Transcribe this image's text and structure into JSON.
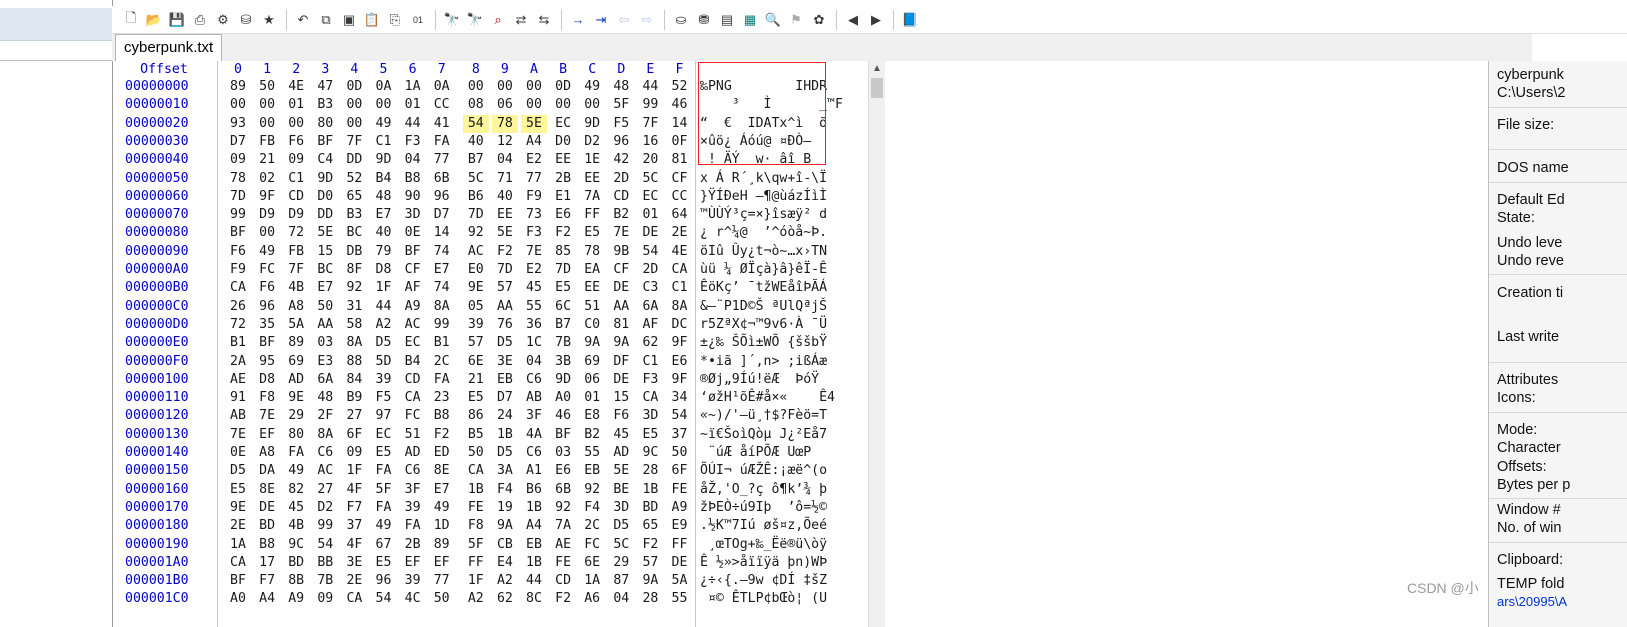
{
  "tab": {
    "filename": "cyberpunk.txt"
  },
  "hex": {
    "offset_header": "Offset",
    "columns": [
      "0",
      "1",
      "2",
      "3",
      "4",
      "5",
      "6",
      "7",
      "8",
      "9",
      "A",
      "B",
      "C",
      "D",
      "E",
      "F"
    ],
    "rows": [
      {
        "off": "00000000",
        "bytes": [
          "89",
          "50",
          "4E",
          "47",
          "0D",
          "0A",
          "1A",
          "0A",
          "00",
          "00",
          "00",
          "0D",
          "49",
          "48",
          "44",
          "52"
        ],
        "text": "‰PNG        IHDR"
      },
      {
        "off": "00000010",
        "bytes": [
          "00",
          "00",
          "01",
          "B3",
          "00",
          "00",
          "01",
          "CC",
          "08",
          "06",
          "00",
          "00",
          "00",
          "5F",
          "99",
          "46"
        ],
        "text": "    ³   Ì      _™F"
      },
      {
        "off": "00000020",
        "bytes": [
          "93",
          "00",
          "00",
          "80",
          "00",
          "49",
          "44",
          "41",
          "54",
          "78",
          "5E",
          "EC",
          "9D",
          "F5",
          "7F",
          "14"
        ],
        "text": "“  €  IDATx^ì  õ "
      },
      {
        "off": "00000030",
        "bytes": [
          "D7",
          "FB",
          "F6",
          "BF",
          "7F",
          "C1",
          "F3",
          "FA",
          "40",
          "12",
          "A4",
          "D0",
          "D2",
          "96",
          "16",
          "0F"
        ],
        "text": "×ûö¿ Áóú@ ¤ÐÒ–  "
      },
      {
        "off": "00000040",
        "bytes": [
          "09",
          "21",
          "09",
          "C4",
          "DD",
          "9D",
          "04",
          "77",
          "B7",
          "04",
          "E2",
          "EE",
          "1E",
          "42",
          "20",
          "81"
        ],
        "text": " ! ÄÝ  w· âî B  "
      },
      {
        "off": "00000050",
        "bytes": [
          "78",
          "02",
          "C1",
          "9D",
          "52",
          "B4",
          "B8",
          "6B",
          "5C",
          "71",
          "77",
          "2B",
          "EE",
          "2D",
          "5C",
          "CF"
        ],
        "text": "x Á R´¸k\\qw+î-\\Ï"
      },
      {
        "off": "00000060",
        "bytes": [
          "7D",
          "9F",
          "CD",
          "D0",
          "65",
          "48",
          "90",
          "96",
          "B6",
          "40",
          "F9",
          "E1",
          "7A",
          "CD",
          "EC",
          "CC"
        ],
        "text": "}ŸÍÐeH –¶@ùázÍìÌ"
      },
      {
        "off": "00000070",
        "bytes": [
          "99",
          "D9",
          "D9",
          "DD",
          "B3",
          "E7",
          "3D",
          "D7",
          "7D",
          "EE",
          "73",
          "E6",
          "FF",
          "B2",
          "01",
          "64"
        ],
        "text": "™ÙÙÝ³ç=×}îsæÿ² d"
      },
      {
        "off": "00000080",
        "bytes": [
          "BF",
          "00",
          "72",
          "5E",
          "BC",
          "40",
          "0E",
          "14",
          "92",
          "5E",
          "F3",
          "F2",
          "E5",
          "7E",
          "DE",
          "2E"
        ],
        "text": "¿ r^¼@  ’^óòå~Þ."
      },
      {
        "off": "00000090",
        "bytes": [
          "F6",
          "49",
          "FB",
          "15",
          "DB",
          "79",
          "BF",
          "74",
          "AC",
          "F2",
          "7E",
          "85",
          "78",
          "9B",
          "54",
          "4E"
        ],
        "text": "öIû Ûy¿t¬ò~…x›TN"
      },
      {
        "off": "000000A0",
        "bytes": [
          "F9",
          "FC",
          "7F",
          "BC",
          "8F",
          "D8",
          "CF",
          "E7",
          "E0",
          "7D",
          "E2",
          "7D",
          "EA",
          "CF",
          "2D",
          "CA"
        ],
        "text": "ùü ¼ ØÏçà}â}êÏ-Ê"
      },
      {
        "off": "000000B0",
        "bytes": [
          "CA",
          "F6",
          "4B",
          "E7",
          "92",
          "1F",
          "AF",
          "74",
          "9E",
          "57",
          "45",
          "E5",
          "EE",
          "DE",
          "C3",
          "C1"
        ],
        "text": "ÊöKç’ ¯tžWEåîÞÃÁ"
      },
      {
        "off": "000000C0",
        "bytes": [
          "26",
          "96",
          "A8",
          "50",
          "31",
          "44",
          "A9",
          "8A",
          "05",
          "AA",
          "55",
          "6C",
          "51",
          "AA",
          "6A",
          "8A"
        ],
        "text": "&–¨P1D©Š ªUlQªjŠ"
      },
      {
        "off": "000000D0",
        "bytes": [
          "72",
          "35",
          "5A",
          "AA",
          "58",
          "A2",
          "AC",
          "99",
          "39",
          "76",
          "36",
          "B7",
          "C0",
          "81",
          "AF",
          "DC"
        ],
        "text": "r5ZªX¢¬™9v6·À ¯Ü"
      },
      {
        "off": "000000E0",
        "bytes": [
          "B1",
          "BF",
          "89",
          "03",
          "8A",
          "D5",
          "EC",
          "B1",
          "57",
          "D5",
          "1C",
          "7B",
          "9A",
          "9A",
          "62",
          "9F"
        ],
        "text": "±¿‰ ŠÕì±WÕ {ššbŸ"
      },
      {
        "off": "000000F0",
        "bytes": [
          "2A",
          "95",
          "69",
          "E3",
          "88",
          "5D",
          "B4",
          "2C",
          "6E",
          "3E",
          "04",
          "3B",
          "69",
          "DF",
          "C1",
          "E6"
        ],
        "text": "*•iã ]´,n> ;ißÁæ"
      },
      {
        "off": "00000100",
        "bytes": [
          "AE",
          "D8",
          "AD",
          "6A",
          "84",
          "39",
          "CD",
          "FA",
          "21",
          "EB",
          "C6",
          "9D",
          "06",
          "DE",
          "F3",
          "9F"
        ],
        "text": "®Ø­j„9Íú!ëÆ  ÞóŸ"
      },
      {
        "off": "00000110",
        "bytes": [
          "91",
          "F8",
          "9E",
          "48",
          "B9",
          "F5",
          "CA",
          "23",
          "E5",
          "D7",
          "AB",
          "A0",
          "01",
          "15",
          "CA",
          "34"
        ],
        "text": "‘øžH¹õÊ#å×«    Ê4"
      },
      {
        "off": "00000120",
        "bytes": [
          "AB",
          "7E",
          "29",
          "2F",
          "27",
          "97",
          "FC",
          "B8",
          "86",
          "24",
          "3F",
          "46",
          "E8",
          "F6",
          "3D",
          "54"
        ],
        "text": "«~)/'—ü¸†$?Fèö=T"
      },
      {
        "off": "00000130",
        "bytes": [
          "7E",
          "EF",
          "80",
          "8A",
          "6F",
          "EC",
          "51",
          "F2",
          "B5",
          "1B",
          "4A",
          "BF",
          "B2",
          "45",
          "E5",
          "37"
        ],
        "text": "~ï€ŠoìQòµ J¿²Eå7"
      },
      {
        "off": "00000140",
        "bytes": [
          "0E",
          "A8",
          "FA",
          "C6",
          "09",
          "E5",
          "AD",
          "ED",
          "50",
          "D5",
          "C6",
          "03",
          "55",
          "AD",
          "9C",
          "50"
        ],
        "text": " ¨úÆ å­íPÕÆ U­œP"
      },
      {
        "off": "00000150",
        "bytes": [
          "D5",
          "DA",
          "49",
          "AC",
          "1F",
          "FA",
          "C6",
          "8E",
          "CA",
          "3A",
          "A1",
          "E6",
          "EB",
          "5E",
          "28",
          "6F"
        ],
        "text": "ÕÚI¬ úÆŽÊ:¡æë^(o"
      },
      {
        "off": "00000160",
        "bytes": [
          "E5",
          "8E",
          "82",
          "27",
          "4F",
          "5F",
          "3F",
          "E7",
          "1B",
          "F4",
          "B6",
          "6B",
          "92",
          "BE",
          "1B",
          "FE"
        ],
        "text": "åŽ‚'O_?ç ô¶k’¾ þ"
      },
      {
        "off": "00000170",
        "bytes": [
          "9E",
          "DE",
          "45",
          "D2",
          "F7",
          "FA",
          "39",
          "49",
          "FE",
          "19",
          "1B",
          "92",
          "F4",
          "3D",
          "BD",
          "A9"
        ],
        "text": "žÞEÒ÷ú9Iþ  ’ô=½©"
      },
      {
        "off": "00000180",
        "bytes": [
          "2E",
          "BD",
          "4B",
          "99",
          "37",
          "49",
          "FA",
          "1D",
          "F8",
          "9A",
          "A4",
          "7A",
          "2C",
          "D5",
          "65",
          "E9"
        ],
        "text": ".½K™7Iú øš¤z,Õeé"
      },
      {
        "off": "00000190",
        "bytes": [
          "1A",
          "B8",
          "9C",
          "54",
          "4F",
          "67",
          "2B",
          "89",
          "5F",
          "CB",
          "EB",
          "AE",
          "FC",
          "5C",
          "F2",
          "FF"
        ],
        "text": " ¸œTOg+‰_Ëë®ü\\òÿ"
      },
      {
        "off": "000001A0",
        "bytes": [
          "CA",
          "17",
          "BD",
          "BB",
          "3E",
          "E5",
          "EF",
          "EF",
          "FF",
          "E4",
          "1B",
          "FE",
          "6E",
          "29",
          "57",
          "DE"
        ],
        "text": "Ê ½»>åïïÿä þn)WÞ"
      },
      {
        "off": "000001B0",
        "bytes": [
          "BF",
          "F7",
          "8B",
          "7B",
          "2E",
          "96",
          "39",
          "77",
          "1F",
          "A2",
          "44",
          "CD",
          "1A",
          "87",
          "9A",
          "5A"
        ],
        "text": "¿÷‹{.–9w ¢DÍ ‡šZ"
      },
      {
        "off": "000001C0",
        "bytes": [
          "A0",
          "A4",
          "A9",
          "09",
          "CA",
          "54",
          "4C",
          "50",
          "A2",
          "62",
          "8C",
          "F2",
          "A6",
          "04",
          "28",
          "55"
        ],
        "text": " ¤© ÊTLP¢bŒò¦ (U"
      }
    ]
  },
  "info_panel": {
    "filename": "cyberpunk",
    "path": "C:\\Users\\2",
    "file_size": "File size:",
    "dos_name": "DOS name",
    "default_edit": "Default Ed",
    "state": "State:",
    "undo_level": "Undo leve",
    "undo_reverse": "Undo reve",
    "creation": "Creation ti",
    "last_write": "Last write",
    "attributes": "Attributes",
    "icons": "Icons:",
    "mode": "Mode:",
    "character": "Character",
    "offsets": "Offsets:",
    "bytes_per": "Bytes per p",
    "window_no": "Window #",
    "no_of_win": "No. of win",
    "clipboard": "Clipboard:",
    "temp_folder": "TEMP fold",
    "temp_path": "ars\\20995\\A"
  },
  "watermark": "CSDN @小",
  "colors": {
    "highlight": "#fff59a",
    "offset_blue": "#0000c8",
    "red_box": "#e22222"
  }
}
